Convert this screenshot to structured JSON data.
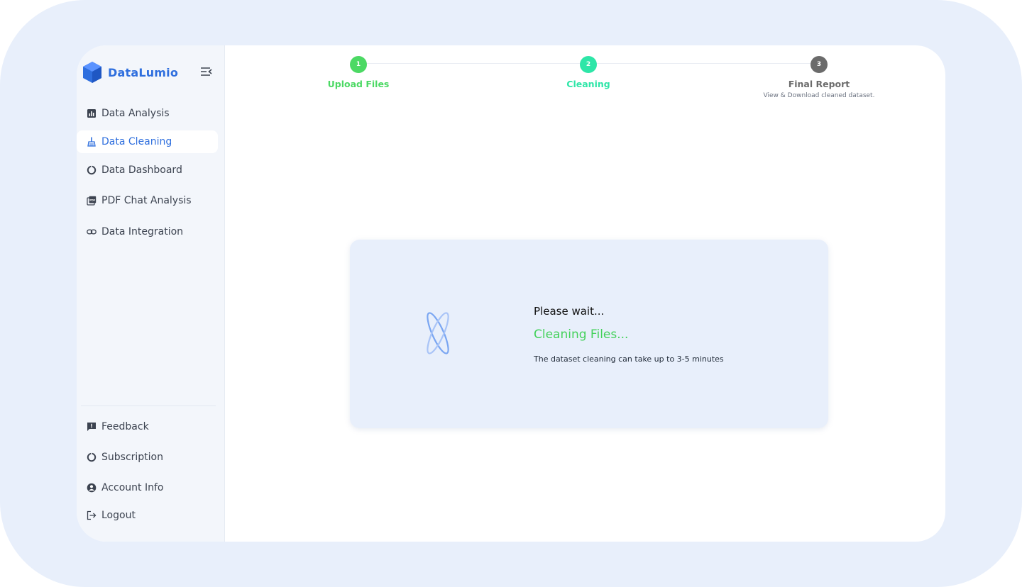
{
  "brand": {
    "name": "DataLumio",
    "accent": "#2f6fde"
  },
  "sidebar": {
    "collapse_icon": "collapse-menu-icon",
    "items": [
      {
        "label": "Data Analysis",
        "icon": "bar-chart-icon",
        "active": false
      },
      {
        "label": "Data Cleaning",
        "icon": "broom-icon",
        "active": true
      },
      {
        "label": "Data Dashboard",
        "icon": "donut-chart-icon",
        "active": false
      },
      {
        "label": "PDF Chat Analysis",
        "icon": "pdf-icon",
        "active": false
      },
      {
        "label": "Data Integration",
        "icon": "link-icon",
        "active": false
      }
    ],
    "bottom_items": [
      {
        "label": "Feedback",
        "icon": "feedback-icon"
      },
      {
        "label": "Subscription",
        "icon": "subscription-icon"
      },
      {
        "label": "Account Info",
        "icon": "account-icon"
      },
      {
        "label": "Logout",
        "icon": "logout-icon"
      }
    ]
  },
  "stepper": {
    "steps": [
      {
        "number": "1",
        "label": "Upload Files",
        "subtitle": "",
        "color": "#4cd964"
      },
      {
        "number": "2",
        "label": "Cleaning",
        "subtitle": "",
        "color": "#2ee6a8"
      },
      {
        "number": "3",
        "label": "Final Report",
        "subtitle": "View & Download cleaned dataset.",
        "color": "#6b6b6b"
      }
    ]
  },
  "loading_card": {
    "title": "Please wait...",
    "status": "Cleaning Files...",
    "note": "The dataset cleaning can take up to 3-5 minutes",
    "status_color": "#43d15a",
    "icon": "atom-loader-icon"
  }
}
